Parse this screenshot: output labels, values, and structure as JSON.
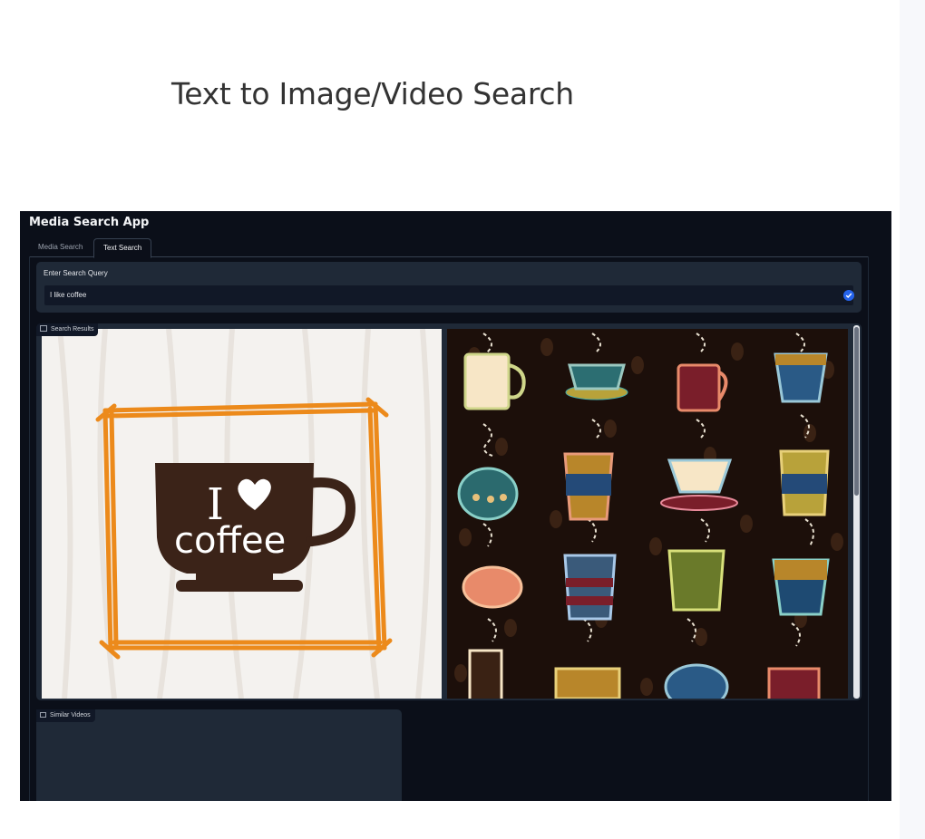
{
  "page": {
    "heading": "Text to Image/Video Search"
  },
  "app": {
    "title": "Media Search App",
    "tabs": [
      {
        "label": "Media Search",
        "active": false
      },
      {
        "label": "Text Search",
        "active": true
      }
    ],
    "query": {
      "label": "Enter Search Query",
      "value": "I like coffee"
    },
    "results": {
      "label": "Search Results",
      "images": [
        {
          "description": "I love coffee cup illustration",
          "text_line1": "I",
          "text_line2": "coffee"
        },
        {
          "description": "Colorful coffee cups pattern on dark background"
        }
      ]
    },
    "videos": {
      "label": "Similar Videos"
    }
  },
  "icons": {
    "query_status": "check-icon",
    "results": "image-icon",
    "videos": "video-icon"
  },
  "colors": {
    "app_bg": "#0b0f19",
    "panel_bg": "#1f2937",
    "accent": "#2563eb",
    "frame_orange": "#ec8a1b",
    "cup_brown": "#3b2318"
  }
}
